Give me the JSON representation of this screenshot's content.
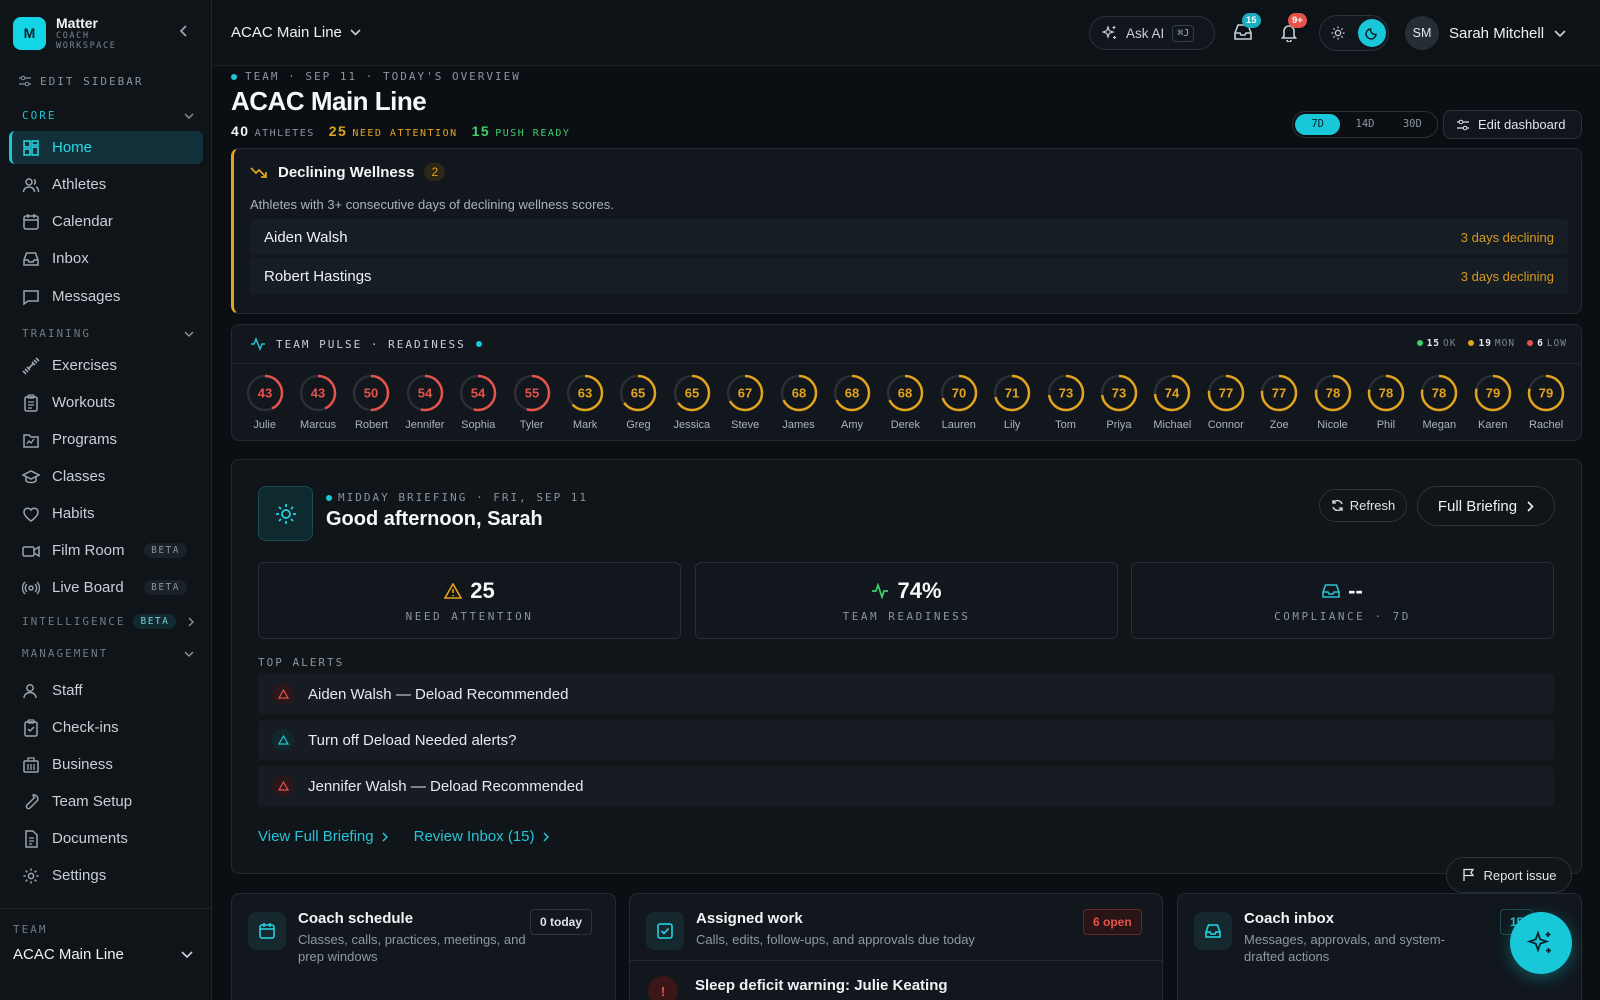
{
  "brand": {
    "name": "Matter",
    "subtitle": "COACH WORKSPACE",
    "logo_letter": "M"
  },
  "sidebar": {
    "edit_label": "EDIT SIDEBAR",
    "sections": {
      "core": "CORE",
      "training": "TRAINING",
      "intelligence": "INTELLIGENCE",
      "intelligence_badge": "BETA",
      "management": "MANAGEMENT"
    },
    "items": [
      {
        "label": "Home",
        "icon": "home-grid-icon"
      },
      {
        "label": "Athletes",
        "icon": "users-icon"
      },
      {
        "label": "Calendar",
        "icon": "calendar-icon"
      },
      {
        "label": "Inbox",
        "icon": "inbox-icon"
      },
      {
        "label": "Messages",
        "icon": "message-icon"
      },
      {
        "label": "Exercises",
        "icon": "dumbbell-icon"
      },
      {
        "label": "Workouts",
        "icon": "clipboard-icon"
      },
      {
        "label": "Programs",
        "icon": "folder-icon"
      },
      {
        "label": "Classes",
        "icon": "graduation-cap-icon"
      },
      {
        "label": "Habits",
        "icon": "heart-icon"
      },
      {
        "label": "Film Room",
        "icon": "video-icon",
        "badge": "BETA"
      },
      {
        "label": "Live Board",
        "icon": "broadcast-icon",
        "badge": "BETA"
      },
      {
        "label": "Staff",
        "icon": "user-icon"
      },
      {
        "label": "Check-ins",
        "icon": "clipboard-check-icon"
      },
      {
        "label": "Business",
        "icon": "building-icon"
      },
      {
        "label": "Team Setup",
        "icon": "wrench-icon"
      },
      {
        "label": "Documents",
        "icon": "document-icon"
      },
      {
        "label": "Settings",
        "icon": "gear-icon"
      }
    ],
    "team_label": "TEAM",
    "team_value": "ACAC Main Line"
  },
  "topbar": {
    "workspace": "ACAC Main Line",
    "ask_ai": "Ask AI",
    "shortcut": "⌘J",
    "inbox_badge": "15",
    "notif_badge": "9+",
    "user_initials": "SM",
    "user_name": "Sarah Mitchell"
  },
  "header": {
    "eyebrow": "TEAM · SEP 11 · TODAY'S OVERVIEW",
    "title": "ACAC Main Line",
    "stats": [
      {
        "value": "40",
        "label": "ATHLETES",
        "color": "#f2f4f6",
        "lcolor": "#8a949d"
      },
      {
        "value": "25",
        "label": "NEED ATTENTION",
        "color": "#e3a31c",
        "lcolor": "#e3a31c"
      },
      {
        "value": "15",
        "label": "PUSH READY",
        "color": "#3ccf6a",
        "lcolor": "#3ccf6a"
      }
    ],
    "ranges": [
      "7D",
      "14D",
      "30D"
    ],
    "active_range": "7D",
    "edit_dashboard": "Edit dashboard"
  },
  "wellness": {
    "title": "Declining Wellness",
    "count": "2",
    "description": "Athletes with 3+ consecutive days of declining wellness scores.",
    "rows": [
      {
        "name": "Aiden Walsh",
        "status": "3 days declining"
      },
      {
        "name": "Robert Hastings",
        "status": "3 days declining"
      }
    ]
  },
  "pulse": {
    "title": "TEAM PULSE · READINESS",
    "legend": [
      {
        "value": "15",
        "label": "OK",
        "color": "#3ccf6a"
      },
      {
        "value": "19",
        "label": "MON",
        "color": "#e3a31c"
      },
      {
        "value": "6",
        "label": "LOW",
        "color": "#e5534b"
      }
    ],
    "athletes": [
      {
        "name": "Julie",
        "score": 43
      },
      {
        "name": "Marcus",
        "score": 43
      },
      {
        "name": "Robert",
        "score": 50
      },
      {
        "name": "Jennifer",
        "score": 54
      },
      {
        "name": "Sophia",
        "score": 54
      },
      {
        "name": "Tyler",
        "score": 55
      },
      {
        "name": "Mark",
        "score": 63
      },
      {
        "name": "Greg",
        "score": 65
      },
      {
        "name": "Jessica",
        "score": 65
      },
      {
        "name": "Steve",
        "score": 67
      },
      {
        "name": "James",
        "score": 68
      },
      {
        "name": "Amy",
        "score": 68
      },
      {
        "name": "Derek",
        "score": 68
      },
      {
        "name": "Lauren",
        "score": 70
      },
      {
        "name": "Lily",
        "score": 71
      },
      {
        "name": "Tom",
        "score": 73
      },
      {
        "name": "Priya",
        "score": 73
      },
      {
        "name": "Michael",
        "score": 74
      },
      {
        "name": "Connor",
        "score": 77
      },
      {
        "name": "Zoe",
        "score": 77
      },
      {
        "name": "Nicole",
        "score": 78
      },
      {
        "name": "Phil",
        "score": 78
      },
      {
        "name": "Megan",
        "score": 78
      },
      {
        "name": "Karen",
        "score": 79
      },
      {
        "name": "Rachel",
        "score": 79
      }
    ]
  },
  "briefing": {
    "eyebrow": "MIDDAY BRIEFING · FRI, SEP 11",
    "greeting": "Good afternoon, Sarah",
    "refresh": "Refresh",
    "full": "Full Briefing",
    "kpis": [
      {
        "value": "25",
        "label": "NEED ATTENTION",
        "icon": "warning-icon",
        "color": "#e3a31c"
      },
      {
        "value": "74%",
        "label": "TEAM READINESS",
        "icon": "activity-icon",
        "color": "#3ccf6a"
      },
      {
        "value": "--",
        "label": "COMPLIANCE · 7D",
        "icon": "inbox-icon",
        "color": "#26c4d6"
      }
    ],
    "alerts_label": "TOP ALERTS",
    "alerts": [
      {
        "text": "Aiden Walsh — Deload Recommended",
        "level": "high"
      },
      {
        "text": "Turn off Deload Needed alerts?",
        "level": "info"
      },
      {
        "text": "Jennifer Walsh — Deload Recommended",
        "level": "high"
      }
    ],
    "link_full": "View Full Briefing",
    "link_inbox": "Review Inbox (15)"
  },
  "report": "Report issue",
  "cards": [
    {
      "title": "Coach schedule",
      "desc": "Classes, calls, practices, meetings, and prep windows",
      "pill": "0 today"
    },
    {
      "title": "Assigned work",
      "desc": "Calls, edits, follow-ups, and approvals due today",
      "pill": "6 open",
      "item": "Sleep deficit warning: Julie Keating"
    },
    {
      "title": "Coach inbox",
      "desc": "Messages, approvals, and system-drafted actions",
      "pill": "15"
    }
  ]
}
